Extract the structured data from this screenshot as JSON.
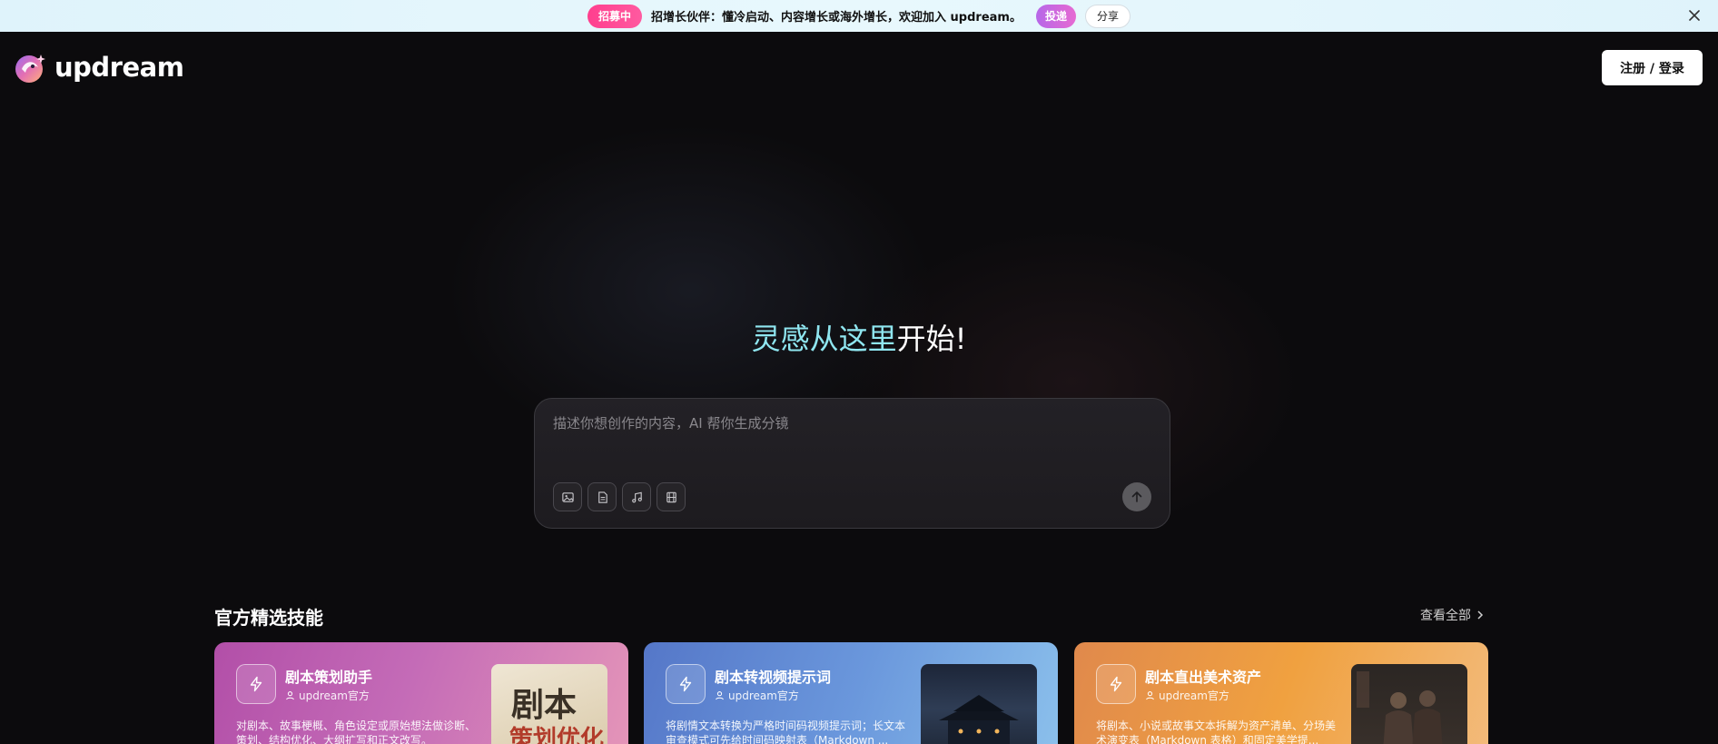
{
  "banner": {
    "hiring_badge": "招募中",
    "text": "招增长伙伴：懂冷启动、内容增长或海外增长，欢迎加入 updream。",
    "submit_label": "投递",
    "share_label": "分享",
    "close_icon": "close-icon"
  },
  "header": {
    "logo_text": "updream",
    "login_label": "注册 / 登录"
  },
  "hero": {
    "title_accent": "灵感从这里",
    "title_rest": "开始!",
    "prompt_placeholder": "描述你想创作的内容，AI 帮你生成分镜",
    "tools": [
      "image-upload-icon",
      "document-icon",
      "music-icon",
      "film-icon"
    ],
    "send_icon": "arrow-up-icon"
  },
  "skills": {
    "section_title": "官方精选技能",
    "view_all_label": "查看全部",
    "cards": [
      {
        "title": "剧本策划助手",
        "author": "updream官方",
        "desc": "对剧本、故事梗概、角色设定或原始想法做诊断、策划、结构优化、大纲扩写和正文改写。",
        "thumb_big": "剧本",
        "thumb_small": "策划优化"
      },
      {
        "title": "剧本转视频提示词",
        "author": "updream官方",
        "desc": "将剧情文本转换为严格时间码视频提示词；长文本审查模式可先给时间码映射表（Markdown ..."
      },
      {
        "title": "剧本直出美术资产",
        "author": "updream官方",
        "desc": "将剧本、小说或故事文本拆解为资产清单、分场美术演变表（Markdown 表格）和固定美学提..."
      }
    ]
  }
}
